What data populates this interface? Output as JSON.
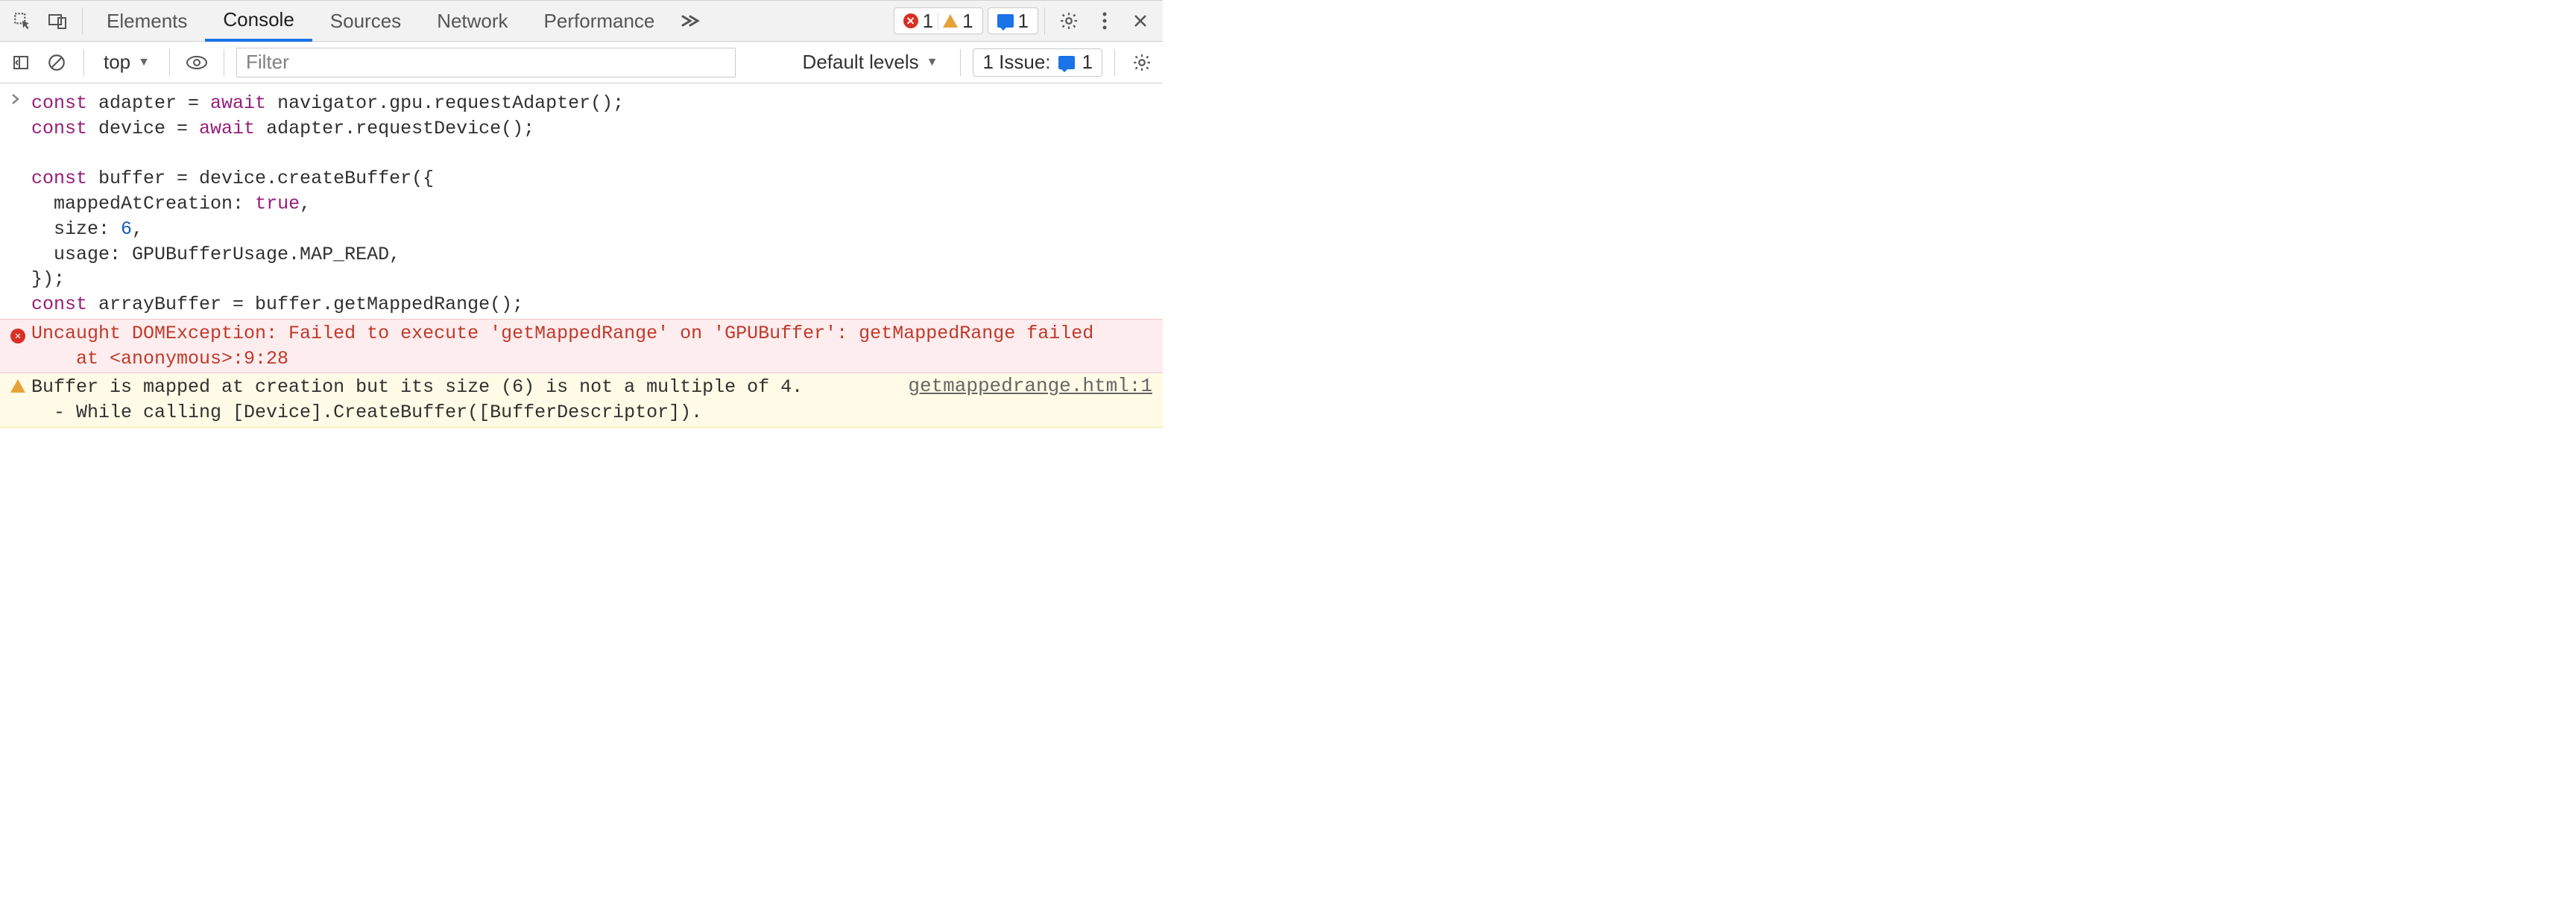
{
  "topbar": {
    "tabs": [
      {
        "label": "Elements",
        "active": false
      },
      {
        "label": "Console",
        "active": true
      },
      {
        "label": "Sources",
        "active": false
      },
      {
        "label": "Network",
        "active": false
      },
      {
        "label": "Performance",
        "active": false
      }
    ],
    "error_count": "1",
    "warn_count": "1",
    "info_count": "1"
  },
  "toolbar": {
    "context": "top",
    "filter_placeholder": "Filter",
    "levels_label": "Default levels",
    "issues_label": "1 Issue:",
    "issues_count": "1"
  },
  "console": {
    "input_code": "const adapter = await navigator.gpu.requestAdapter();\nconst device = await adapter.requestDevice();\n\nconst buffer = device.createBuffer({\n  mappedAtCreation: true,\n  size: 6,\n  usage: GPUBufferUsage.MAP_READ,\n});\nconst arrayBuffer = buffer.getMappedRange();",
    "error_text": "Uncaught DOMException: Failed to execute 'getMappedRange' on 'GPUBuffer': getMappedRange failed\n    at <anonymous>:9:28",
    "warn_text": "Buffer is mapped at creation but its size (6) is not a multiple of 4.\n  - While calling [Device].CreateBuffer([BufferDescriptor]).",
    "warn_source": "getmappedrange.html:1"
  },
  "colors": {
    "accent": "#1a73e8",
    "error": "#d93025",
    "warn": "#e8a23a"
  }
}
